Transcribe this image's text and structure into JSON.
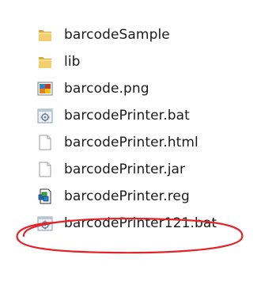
{
  "files": [
    {
      "name": "barcodeSample",
      "icon": "folder-icon"
    },
    {
      "name": "lib",
      "icon": "folder-icon"
    },
    {
      "name": "barcode.png",
      "icon": "image-file-icon"
    },
    {
      "name": "barcodePrinter.bat",
      "icon": "batch-file-icon"
    },
    {
      "name": "barcodePrinter.html",
      "icon": "blank-file-icon"
    },
    {
      "name": "barcodePrinter.jar",
      "icon": "blank-file-icon"
    },
    {
      "name": "barcodePrinter.reg",
      "icon": "registry-file-icon"
    },
    {
      "name": "barcodePrinter121.bat",
      "icon": "batch-file-icon"
    }
  ],
  "colors": {
    "highlight": "#e0252b",
    "folder": "#e9c46a",
    "text": "#1a1a1a"
  }
}
